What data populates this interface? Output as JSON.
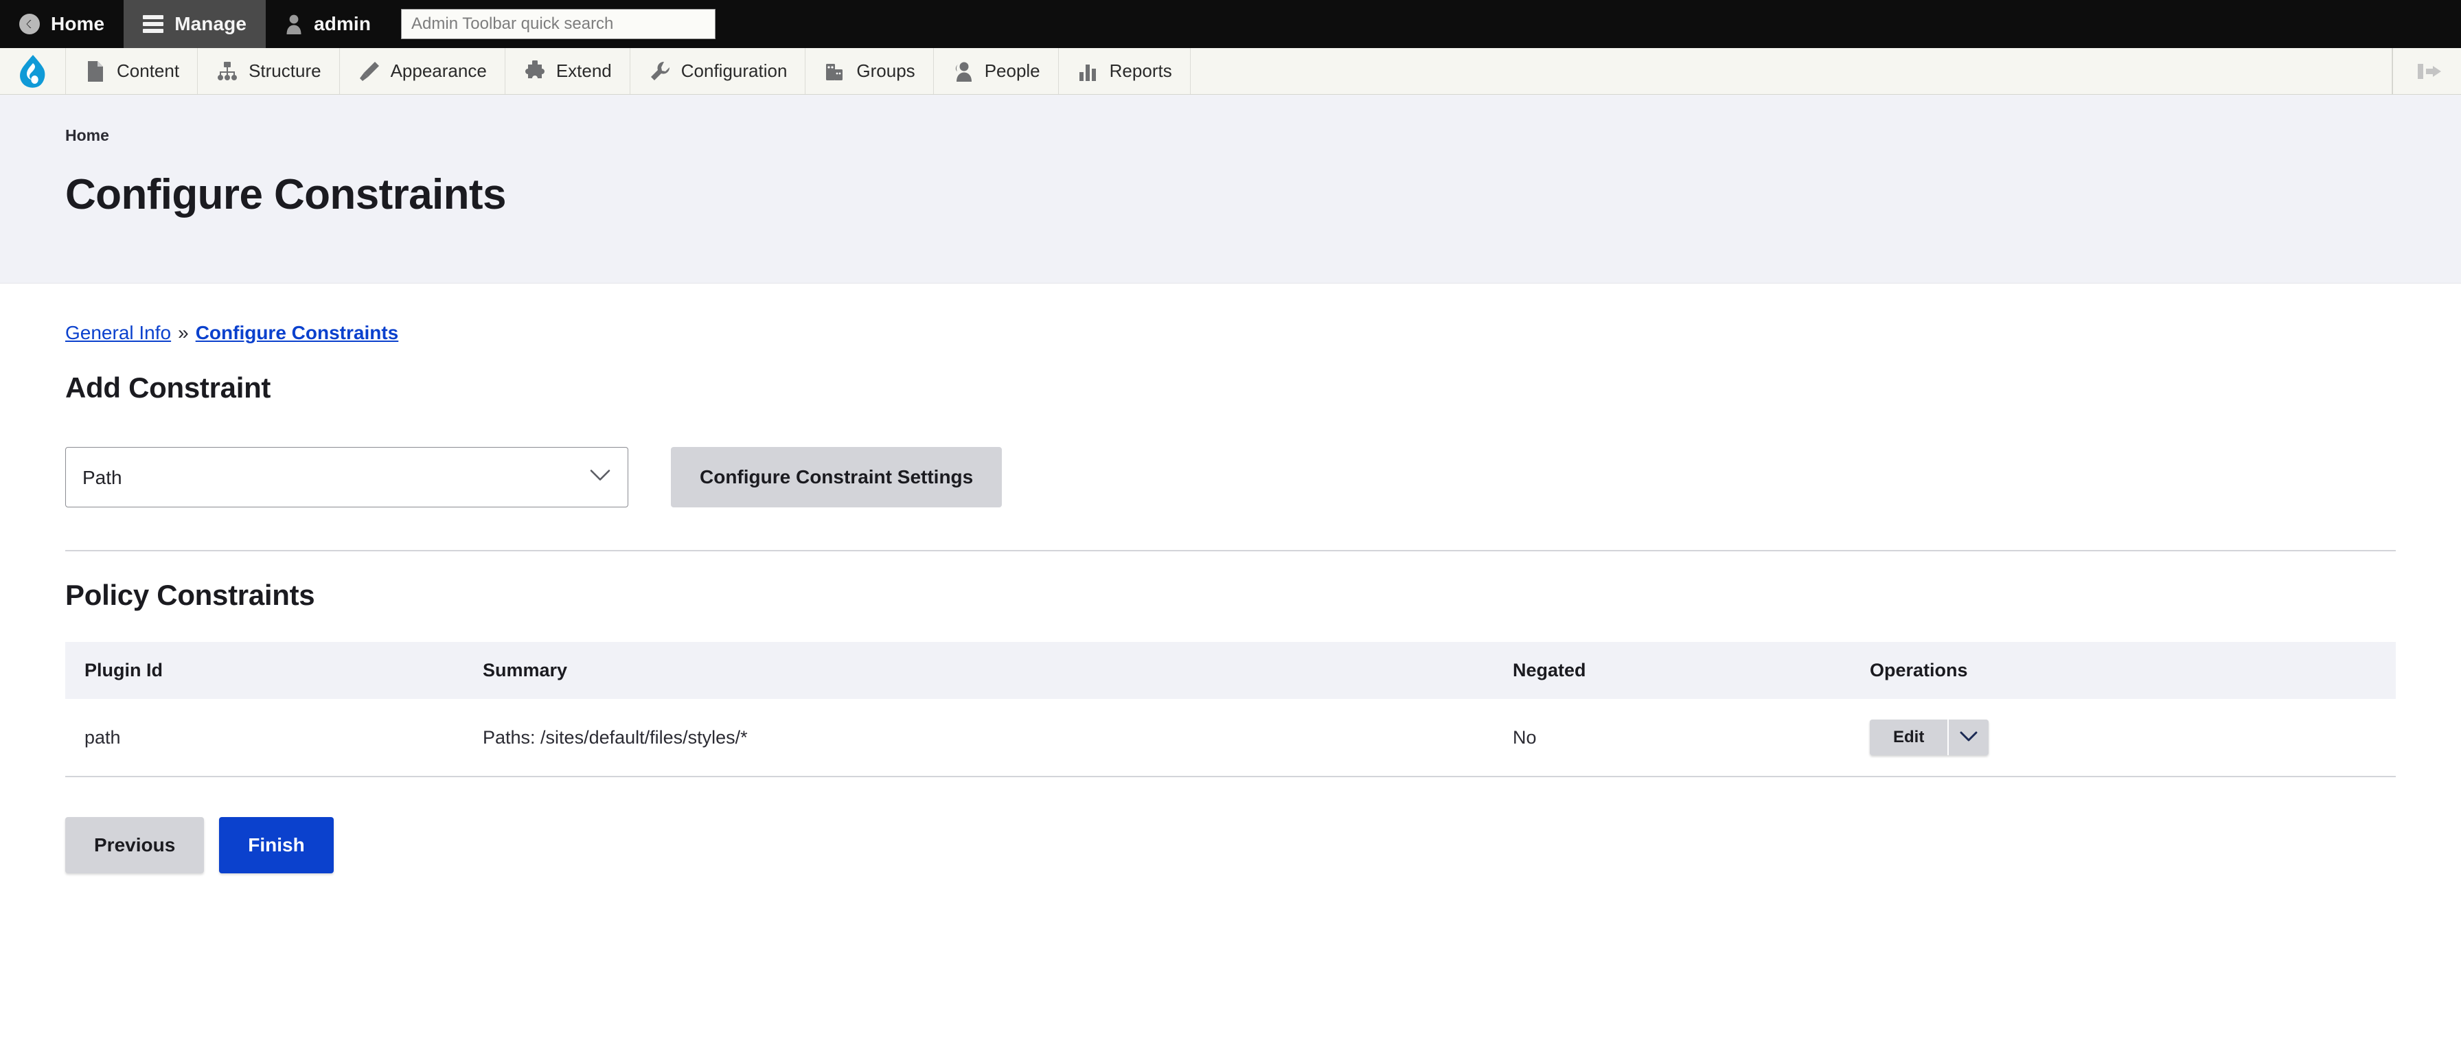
{
  "admin_bar": {
    "home_label": "Home",
    "manage_label": "Manage",
    "user_label": "admin",
    "search_placeholder": "Admin Toolbar quick search",
    "search_value": ""
  },
  "menu_bar": {
    "logo_name": "drupal-logo-icon",
    "items": [
      {
        "label": "Content",
        "icon": "file-icon"
      },
      {
        "label": "Structure",
        "icon": "sitemap-icon"
      },
      {
        "label": "Appearance",
        "icon": "paintbrush-icon"
      },
      {
        "label": "Extend",
        "icon": "puzzle-piece-icon"
      },
      {
        "label": "Configuration",
        "icon": "wrench-icon"
      },
      {
        "label": "Groups",
        "icon": "people-group-icon"
      },
      {
        "label": "People",
        "icon": "person-icon"
      },
      {
        "label": "Reports",
        "icon": "bar-chart-icon"
      }
    ],
    "orientation_toggle": "vertical-orientation-toggle-icon"
  },
  "page_header": {
    "breadcrumb": "Home",
    "title": "Configure Constraints"
  },
  "wizard": {
    "step_general_info": "General Info",
    "separator": "»",
    "step_configure_constraints": "Configure Constraints"
  },
  "add_constraint": {
    "heading": "Add Constraint",
    "plugin_select_value": "Path",
    "plugin_select_options": [
      "Path"
    ],
    "configure_button": "Configure Constraint Settings"
  },
  "policy_constraints": {
    "heading": "Policy Constraints",
    "columns": [
      "Plugin Id",
      "Summary",
      "Negated",
      "Operations"
    ],
    "rows": [
      {
        "plugin_id": "path",
        "summary": "Paths: /sites/default/files/styles/*",
        "negated": "No",
        "operation_label": "Edit"
      }
    ]
  },
  "actions": {
    "previous": "Previous",
    "finish": "Finish"
  },
  "colors": {
    "accent_blue": "#0b41cd",
    "drupal_blue": "#109ad7",
    "header_band": "#f1f2f7",
    "button_grey": "#d3d4d9",
    "toolbar_black": "#0d0d0d",
    "menu_bar_bg": "#f6f6f1"
  }
}
